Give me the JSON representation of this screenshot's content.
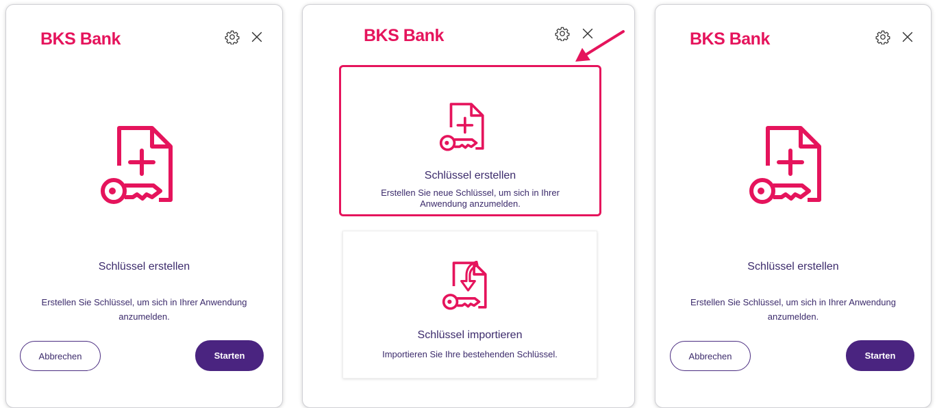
{
  "colors": {
    "brand": "#e5145c",
    "primary": "#4a2480",
    "text": "#3b2a6b"
  },
  "left_panel": {
    "logo": "BKS Bank",
    "settings_icon": "gear-icon",
    "close_icon": "close-icon",
    "illustration_icon": "create-key-document-icon",
    "title": "Schlüssel erstellen",
    "description": "Erstellen Sie Schlüssel, um sich in Ihrer Anwendung anzumelden.",
    "cancel_label": "Abbrechen",
    "start_label": "Starten"
  },
  "middle_panel": {
    "logo": "BKS Bank",
    "settings_icon": "gear-icon",
    "close_icon": "close-icon",
    "options": [
      {
        "icon": "create-key-document-icon",
        "title": "Schlüssel erstellen",
        "description": "Erstellen Sie neue Schlüssel, um sich in Ihrer Anwendung anzumelden.",
        "highlighted": true
      },
      {
        "icon": "import-key-document-icon",
        "title": "Schlüssel importieren",
        "description": "Importieren Sie Ihre bestehenden Schlüssel.",
        "highlighted": false
      }
    ]
  },
  "right_panel": {
    "logo": "BKS Bank",
    "settings_icon": "gear-icon",
    "close_icon": "close-icon",
    "illustration_icon": "create-key-document-icon",
    "title": "Schlüssel erstellen",
    "description": "Erstellen Sie Schlüssel, um sich in Ihrer Anwendung anzumelden.",
    "cancel_label": "Abbrechen",
    "start_label": "Starten"
  },
  "annotation": {
    "icon": "pointer-arrow-icon"
  }
}
